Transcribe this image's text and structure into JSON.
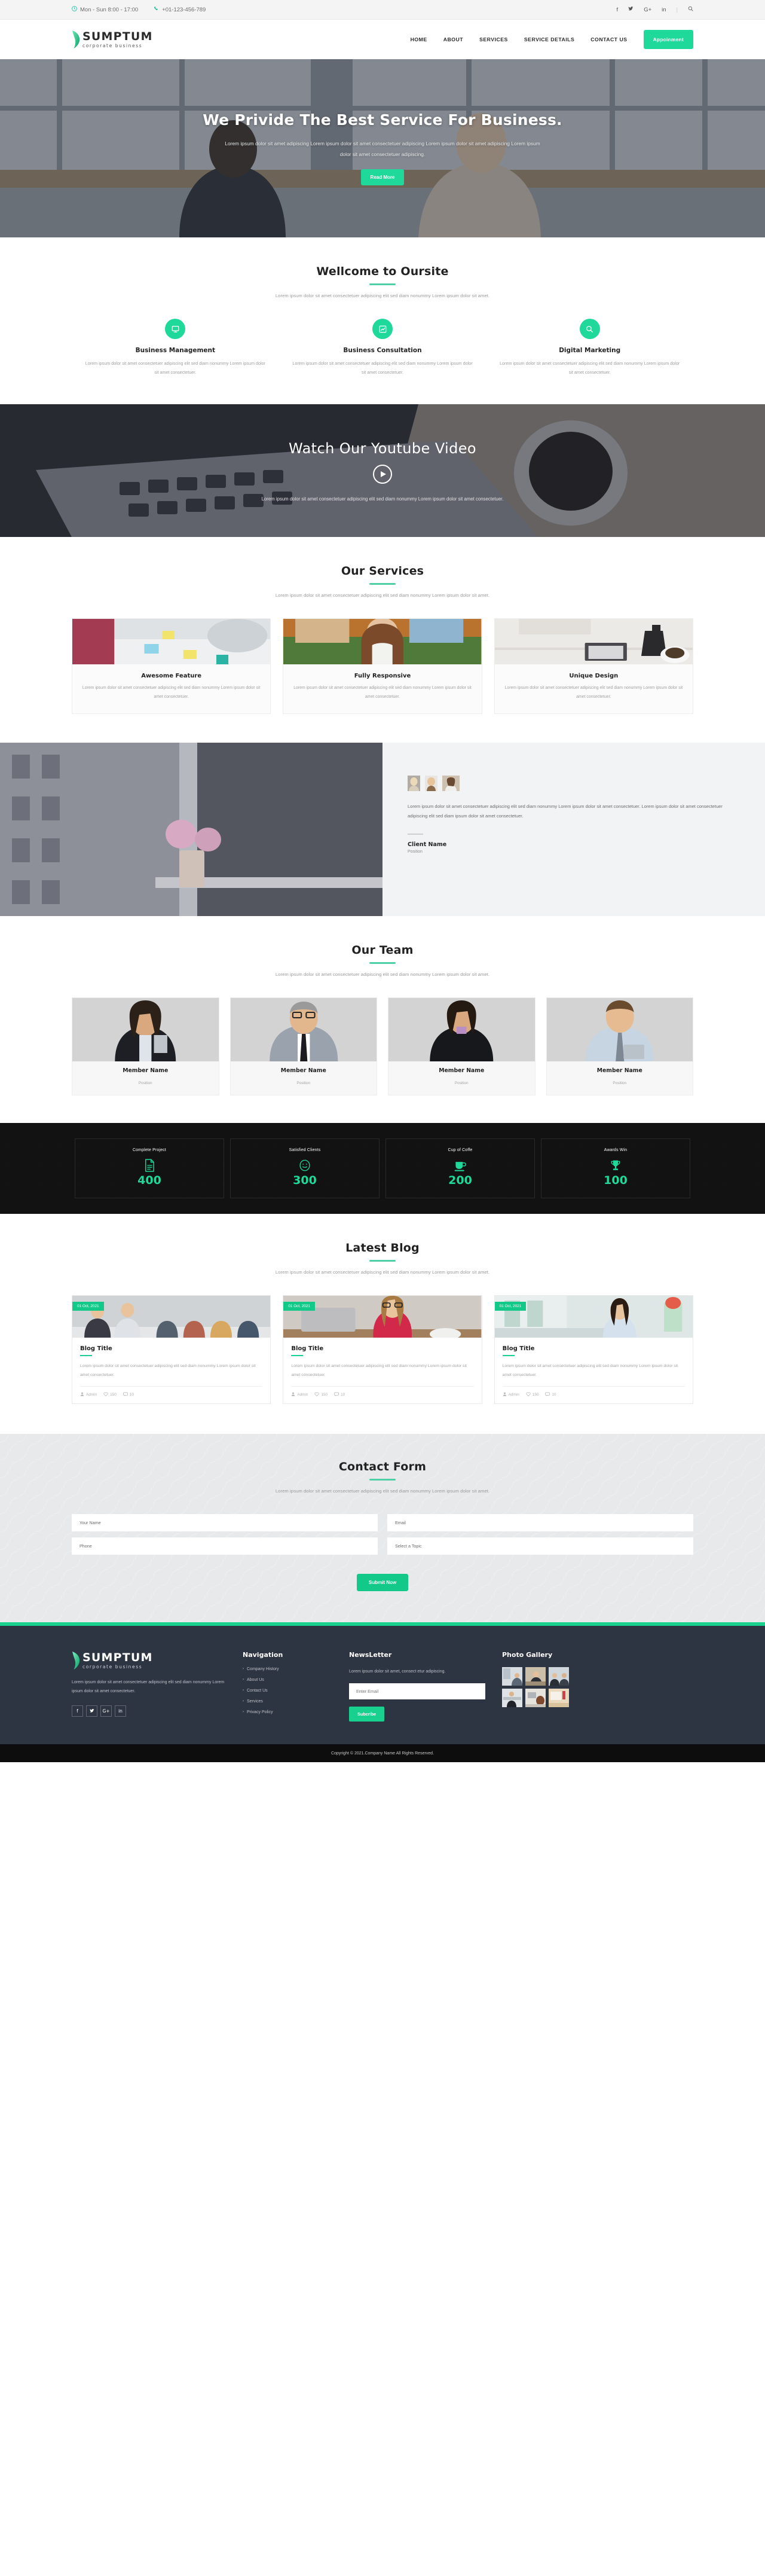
{
  "topbar": {
    "hours_icon": "clock-icon",
    "hours": "Mon - Sun 8:00 - 17:00",
    "phone_icon": "phone-icon",
    "phone": "+01-123-456-789",
    "social": [
      {
        "name": "facebook-icon",
        "glyph": "f"
      },
      {
        "name": "twitter-icon",
        "glyph": "ᴠ"
      },
      {
        "name": "google-plus-icon",
        "glyph": "G+"
      },
      {
        "name": "linkedin-icon",
        "glyph": "in"
      }
    ],
    "search_icon": "search-icon"
  },
  "header": {
    "logo_name": "SUMPTUM",
    "logo_sub": "corporate  business",
    "nav": [
      {
        "label": "HOME"
      },
      {
        "label": "ABOUT"
      },
      {
        "label": "SERVICES"
      },
      {
        "label": "SERVICE DETAILS"
      },
      {
        "label": "CONTACT US"
      }
    ],
    "cta_label": "Appoinment"
  },
  "hero": {
    "title": "We Privide The Best Service For Business.",
    "paragraph": "Lorem ipsum dolor sit amet adipiscing Lorem ipsum dolor sit amet consectetuer adipiscing Lorem ipsum dolor sit amet adipiscing Lorem ipsum dolor sit amet consectetuer adipiscing.",
    "cta_label": "Read More"
  },
  "welcome": {
    "title": "Wellcome to Oursite",
    "subtitle": "Lorem ipsum dolor sit amet consectetuer adipiscing elit sed diam nonummy Lorem ipsum dolor sit amet.",
    "features": [
      {
        "icon": "monitor-icon",
        "title": "Business Management",
        "text": "Lorem ipsum dolor sit amet consectetuer adipiscing elit sed diam nonummy Lorem ipsum dolor sit amet consectetuer."
      },
      {
        "icon": "chart-line-icon",
        "title": "Business Consultation",
        "text": "Lorem ipsum dolor sit amet consectetuer adipiscing elit sed diam nonummy Lorem ipsum dolor sit amet consectetuer."
      },
      {
        "icon": "search-icon",
        "title": "Digital Marketing",
        "text": "Lorem ipsum dolor sit amet consectetuer adipiscing elit sed diam nonummy Lorem ipsum dolor sit amet consectetuer."
      }
    ]
  },
  "video": {
    "title": "Watch Our Youtube Video",
    "play_icon": "play-icon",
    "paragraph": "Lorem ipsum dolor sit amet consectetuer adipiscing elit sed diam nonummy Lorem ipsum dolor sit amet consectetuer."
  },
  "services": {
    "title": "Our Services",
    "subtitle": "Lorem ipsum dolor sit amet consectetuer adipiscing elit sed diam nonummy Lorem ipsum dolor sit amet.",
    "cards": [
      {
        "title": "Awesome Feature",
        "text": "Lorem ipsum dolor sit amet consectetuer adipiscing elit sed diam nonummy Lorem ipsum dolor sit amet consectetuer."
      },
      {
        "title": "Fully Responsive",
        "text": "Lorem ipsum dolor sit amet consectetuer adipiscing elit sed diam nonummy Lorem ipsum dolor sit amet consectetuer."
      },
      {
        "title": "Unique Design",
        "text": "Lorem ipsum dolor sit amet consectetuer adipiscing elit sed diam nonummy Lorem ipsum dolor sit amet consectetuer."
      }
    ]
  },
  "testimonial": {
    "quote": "Lorem ipsum dolor sit amet consectetuer adipiscing elit sed diam nonummy Lorem ipsum dolor sit amet consectetuer. Lorem ipsum dolor sit amet consectetuer adipiscing elit sed diam ipsum dolor sit amet consectetuer.",
    "client_name": "Client Name",
    "client_position": "Position",
    "avatar_count": 3
  },
  "team": {
    "title": "Our Team",
    "subtitle": "Lorem ipsum dolor sit amet consectetuer adipiscing elit sed diam nonummy Lorem ipsum dolor sit amet.",
    "members": [
      {
        "name": "Member Name",
        "position": "Position"
      },
      {
        "name": "Member Name",
        "position": "Position"
      },
      {
        "name": "Member Name",
        "position": "Position"
      },
      {
        "name": "Member Name",
        "position": "Position"
      }
    ]
  },
  "counter": {
    "items": [
      {
        "label": "Complete Project",
        "icon": "document-icon",
        "value": "400"
      },
      {
        "label": "Satisfied Clients",
        "icon": "smiley-icon",
        "value": "300"
      },
      {
        "label": "Cup of Coffe",
        "icon": "coffee-cup-icon",
        "value": "200"
      },
      {
        "label": "Awards Win",
        "icon": "trophy-icon",
        "value": "100"
      }
    ]
  },
  "blog": {
    "title": "Latest Blog",
    "subtitle": "Lorem ipsum dolor sit amet consectetuer adipiscing elit sed diam nonummy Lorem ipsum dolor sit amet.",
    "posts": [
      {
        "date": "01 Oct, 2021",
        "title": "Blog Title",
        "text": "Lorem ipsum dolor sit amet consectetuer adipiscing elit sed diam nonummy Lorem ipsum dolor sit amet consectetuer.",
        "author": "Admin",
        "likes": "150",
        "comments": "10"
      },
      {
        "date": "01 Oct, 2021",
        "title": "Blog Title",
        "text": "Lorem ipsum dolor sit amet consectetuer adipiscing elit sed diam nonummy Lorem ipsum dolor sit amet consectetuer.",
        "author": "Admin",
        "likes": "150",
        "comments": "10"
      },
      {
        "date": "01 Oct, 2021",
        "title": "Blog Title",
        "text": "Lorem ipsum dolor sit amet consectetuer adipiscing elit sed diam nonummy Lorem ipsum dolor sit amet consectetuer.",
        "author": "Admin",
        "likes": "150",
        "comments": "10"
      }
    ]
  },
  "contact": {
    "title": "Contact Form",
    "subtitle": "Lorem ipsum dolor sit amet consectetuer adipiscing elit sed diam nonummy Lorem ipsum dolor sit amet.",
    "fields": {
      "name_placeholder": "Your Name",
      "email_placeholder": "Email",
      "phone_placeholder": "Phone",
      "topic_placeholder": "Select a Topic"
    },
    "submit_label": "Submit Now"
  },
  "footer": {
    "logo_name": "SUMPTUM",
    "logo_sub": "corporate  business",
    "about": "Lorem ipsum dolor sit amet consectetuer adipiscing elit sed diam nonummy Lorem ipsum dolor sit amet consectetuer.",
    "social": [
      {
        "name": "facebook-icon",
        "glyph": "f"
      },
      {
        "name": "twitter-icon",
        "glyph": "ᴠ"
      },
      {
        "name": "google-plus-icon",
        "glyph": "G+"
      },
      {
        "name": "linkedin-icon",
        "glyph": "in"
      }
    ],
    "nav_title": "Navigation",
    "nav_items": [
      {
        "label": "Company History"
      },
      {
        "label": "About Us"
      },
      {
        "label": "Contact Us"
      },
      {
        "label": "Services"
      },
      {
        "label": "Privacy Policy"
      }
    ],
    "news_title": "NewsLetter",
    "news_text": "Lorem ipsum dolor sit amet, consect etur adipiscing.",
    "news_placeholder": "Enter Email",
    "news_button": "Subcribe",
    "gallery_title": "Photo Gallery",
    "gallery_count": 6,
    "copyright": "Copyright © 2021.Company Name All Rights Reserved."
  },
  "colors": {
    "accent": "#1ed99a",
    "accent_dark": "#12c98a",
    "rule": "#4ecfa5",
    "dark": "#2f3542",
    "counter_bg": "#121212"
  }
}
